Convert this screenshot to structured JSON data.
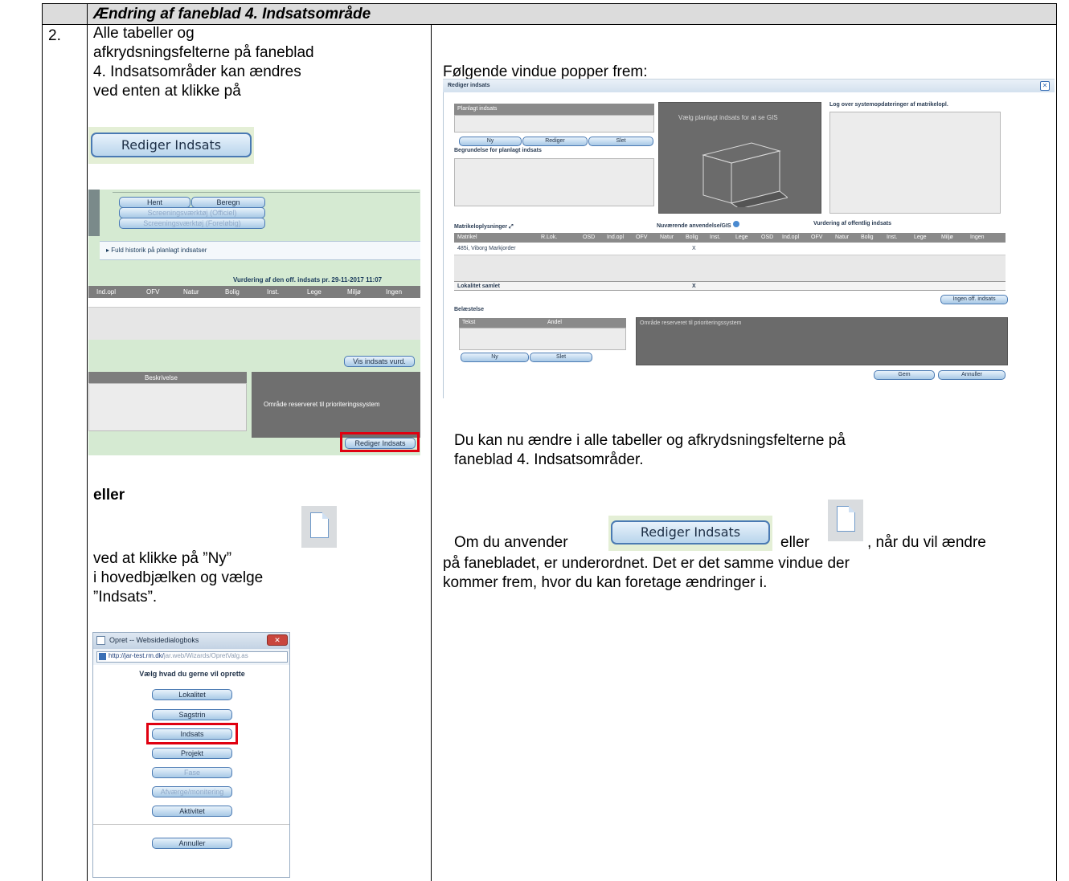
{
  "header": {
    "title": "Ændring af faneblad 4. Indsatsområde"
  },
  "row_number": "2.",
  "left": {
    "para1": [
      "Alle tabeller og",
      "afkrydsningsfelterne på faneblad",
      "4. Indsatsområder kan ændres",
      "ved enten at klikke på"
    ],
    "rediger_button": "Rediger Indsats",
    "screenshot1": {
      "hent": "Hent",
      "beregn": "Beregn",
      "disabled1": "Screeningsværktøj (Officiel)",
      "disabled2": "Screeningsværktøj (Foreløbig)",
      "history_link": "Fuld historik på planlagt indsatser",
      "vurdering": "Vurdering af den off. indsats pr. 29-11-2017 11:07",
      "cols": [
        "Ind.opl",
        "OFV",
        "Natur",
        "Bolig",
        "Inst.",
        "Lege",
        "Miljø",
        "Ingen"
      ],
      "vis_btn": "Vis indsats vurd.",
      "beskrivelse": "Beskrivelse",
      "reserved": "Område reserveret til prioriteringssystem",
      "rediger_small": "Rediger Indsats"
    },
    "eller": "eller",
    "para2": [
      "ved at klikke på ”Ny”",
      "i hovedbjælken og vælge",
      "”Indsats”."
    ],
    "dialog": {
      "title": "Opret -- Websidedialogboks",
      "url_dark": "http://jar-test.rm.dk/",
      "url_light": "jar.web/Wizards/OpretValg.as",
      "heading": "Vælg hvad du gerne vil oprette",
      "buttons": [
        "Lokalitet",
        "Sagstrin",
        "Indsats",
        "Projekt",
        "Fase",
        "Afværge/monitering",
        "Aktivitet"
      ],
      "annuller": "Annuller"
    }
  },
  "right": {
    "intro": "Følgende vindue popper frem:",
    "screenshot2": {
      "window_title": "Rediger indsats",
      "planlagt": "Planlagt indsats",
      "gis_text": "Vælg planlagt indsats for at se GIS",
      "log": "Log over systemopdateringer af matrikelopl.",
      "ny": "Ny",
      "rediger": "Rediger",
      "slet": "Slet",
      "begrundelse": "Begrundelse for planlagt indsats",
      "matrikel_title": "Matrikeloplysninger",
      "navaerende": "Nuværende anvendelse/GIS",
      "vurdering": "Vurdering af offentlig indsats",
      "cols": [
        "Matrikel",
        "R.Lok.",
        "OSD",
        "Ind.opl",
        "OFV",
        "Natur",
        "Bolig",
        "Inst.",
        "Lege",
        "OSD",
        "Ind.opl",
        "OFV",
        "Natur",
        "Bolig",
        "Inst.",
        "Lege",
        "Miljø",
        "Ingen"
      ],
      "row1": "485i, Viborg Markjorder",
      "x1": "X",
      "lokalitet": "Lokalitet samlet",
      "x2": "X",
      "ingen_btn": "Ingen off. indsats",
      "belastelse": "Belæstelse",
      "tekst": "Tekst",
      "andel": "Andel",
      "reserved": "Område reserveret til prioriteringssystem",
      "ny2": "Ny",
      "slet2": "Slet",
      "gem": "Gem",
      "annuller": "Annuller"
    },
    "para1": [
      "Du kan nu ændre i alle tabeller og afkrydsningsfelterne på",
      "faneblad 4. Indsatsområder."
    ],
    "om_du": "Om du anvender",
    "eller": "eller",
    "naar": ", når du vil ændre",
    "para2": [
      "på fanebladet, er underordnet. Det er det samme vindue der",
      "kommer frem, hvor du kan foretage ændringer i."
    ],
    "rediger_button": "Rediger Indsats"
  }
}
